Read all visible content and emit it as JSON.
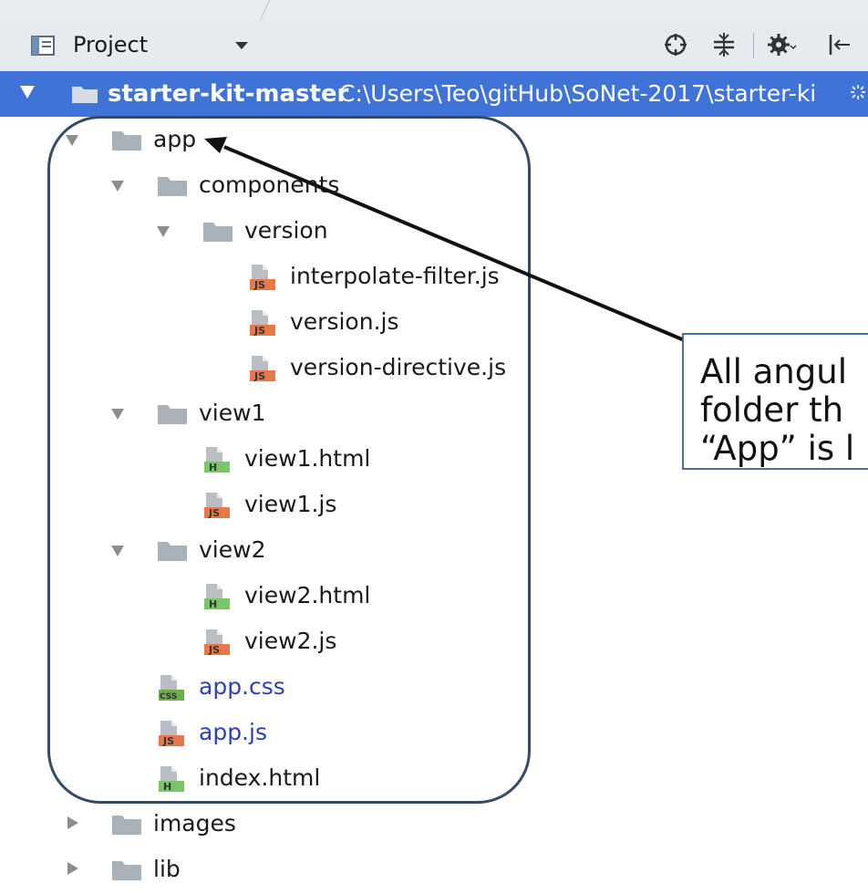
{
  "toolbar": {
    "project_label": "Project",
    "icons": [
      "project-view-icon",
      "dropdown-icon",
      "locate-icon",
      "collapse-all-icon",
      "settings-icon",
      "hide-panel-icon"
    ]
  },
  "root": {
    "name": "starter-kit-master",
    "path": "C:\\Users\\Teo\\gitHub\\SoNet-2017\\starter-ki"
  },
  "tree": [
    {
      "label": "app",
      "type": "folder",
      "expanded": true
    },
    {
      "label": "components",
      "type": "folder",
      "expanded": true
    },
    {
      "label": "version",
      "type": "folder",
      "expanded": true
    },
    {
      "label": "interpolate-filter.js",
      "type": "js"
    },
    {
      "label": "version.js",
      "type": "js"
    },
    {
      "label": "version-directive.js",
      "type": "js"
    },
    {
      "label": "view1",
      "type": "folder",
      "expanded": true
    },
    {
      "label": "view1.html",
      "type": "html"
    },
    {
      "label": "view1.js",
      "type": "js"
    },
    {
      "label": "view2",
      "type": "folder",
      "expanded": true
    },
    {
      "label": "view2.html",
      "type": "html"
    },
    {
      "label": "view2.js",
      "type": "js"
    },
    {
      "label": "app.css",
      "type": "css"
    },
    {
      "label": "app.js",
      "type": "js"
    },
    {
      "label": "index.html",
      "type": "html"
    },
    {
      "label": "images",
      "type": "folder",
      "expanded": false
    },
    {
      "label": "lib",
      "type": "folder",
      "expanded": false
    }
  ],
  "file_badges": {
    "js": "JS",
    "html": "H",
    "css": "CSS"
  },
  "callout": {
    "lines": [
      "All angul",
      "folder th",
      "“App” is l"
    ]
  },
  "colors": {
    "selection": "#3f73d8",
    "folder": "#a9b1b9",
    "js_badge": "#e8784a",
    "html_badge": "#7cc46a",
    "css_badge": "#6ab04c",
    "vcs_added_text": "#2b3fbf",
    "highlight_box": "#334b66",
    "arrow": "#111111"
  }
}
